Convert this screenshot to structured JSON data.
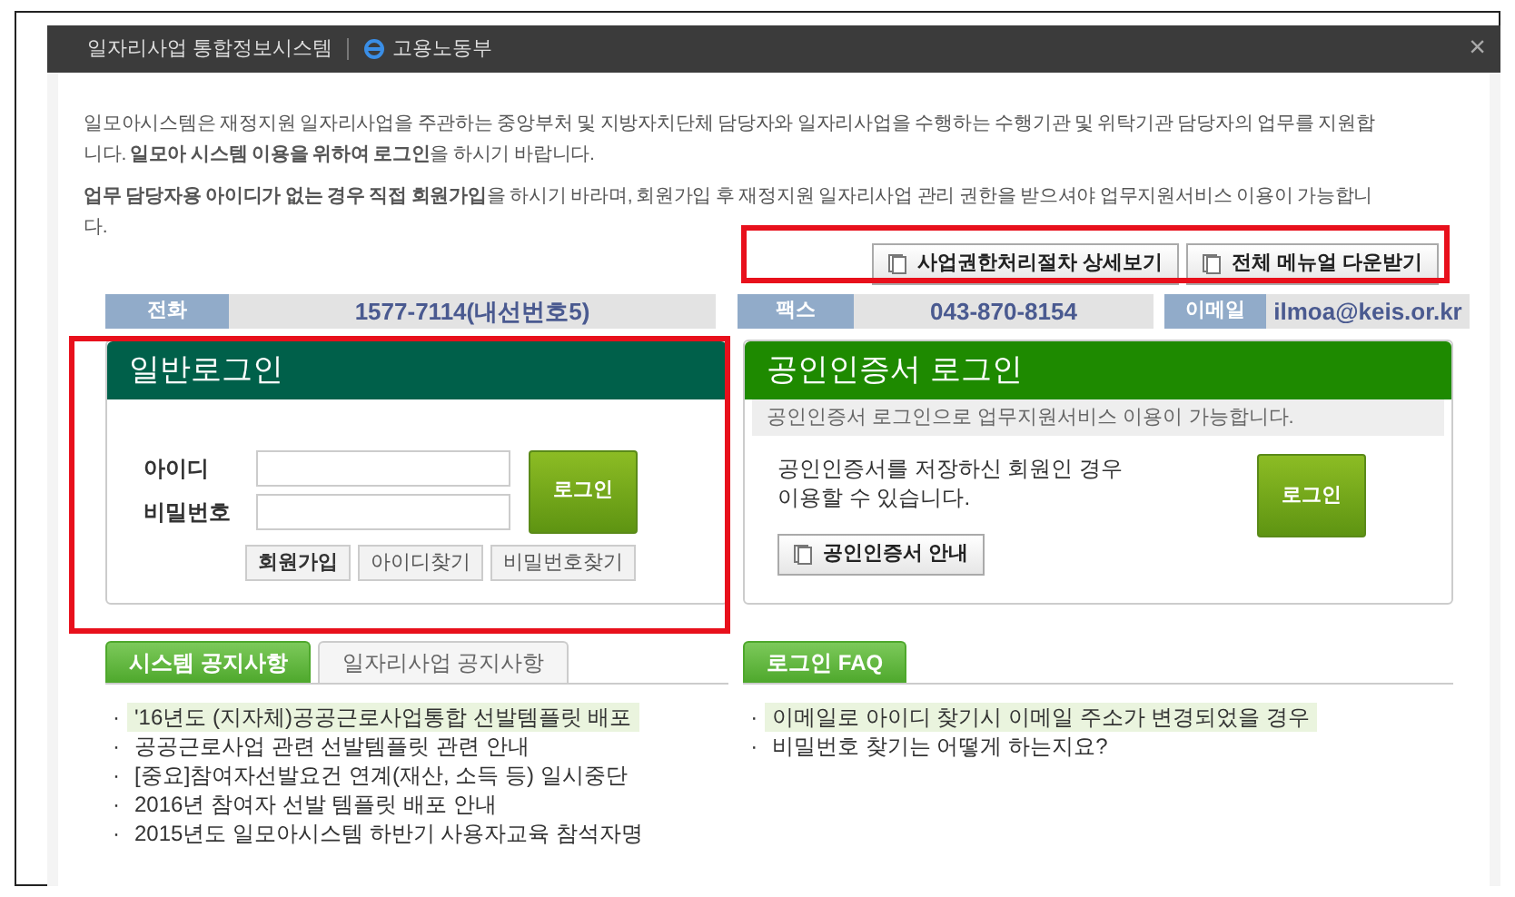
{
  "window": {
    "title_tabs": [
      {
        "label": "일자리사업 통합정보시스템",
        "kind": "text"
      },
      {
        "label": "고용노동부",
        "kind": "logo"
      }
    ],
    "close": "×"
  },
  "intro": [
    "일모아시스템은 재정지원 일자리사업을 주관하는 중앙부처 및 지방자치단체 담당자와 일자리사업을 수행하는 수행기관 및 위탁기관 담당자의 업무를 지원합니다. **일모아 시스템 이용을 위하여 로그인**을 하시기 바랍니다.",
    "**업무 담당자용 아이디가 없는 경우 직접 회원가입**을 하시기 바라며, 회원가입 후 재정지원 일자리사업 관리 권한을 받으셔야 업무지원서비스 이용이 가능합니다."
  ],
  "top_buttons": [
    "사업권한처리절차 상세보기",
    "전체 메뉴얼 다운받기"
  ],
  "contacts": [
    {
      "label": "전화",
      "value": "1577-7114(내선번호5)"
    },
    {
      "label": "팩스",
      "value": "043-870-8154"
    },
    {
      "label": "이메일",
      "value": "ilmoa@keis.or.kr"
    }
  ],
  "general_login": {
    "title": "일반로그인",
    "fields": [
      {
        "label": "아이디"
      },
      {
        "label": "비밀번호"
      }
    ],
    "login_button": "로그인",
    "links": [
      {
        "label": "회원가입",
        "bold": true
      },
      {
        "label": "아이디찾기",
        "bold": false
      },
      {
        "label": "비밀번호찾기",
        "bold": false
      }
    ]
  },
  "cert_login": {
    "title": "공인인증서 로그인",
    "subtitle": "공인인증서 로그인으로 업무지원서비스 이용이 가능합니다.",
    "note": "공인인증서를 저장하신 회원인 경우\n이용할 수 있습니다.",
    "login_button": "로그인",
    "guide_button": "공인인증서 안내"
  },
  "notices": {
    "tabs": [
      {
        "label": "시스템 공지사항",
        "selected": true
      },
      {
        "label": "일자리사업 공지사항",
        "selected": false
      }
    ],
    "items": [
      {
        "bullet": "·",
        "text": "'16년도 (지자체)공공근로사업통합 선발템플릿 배포",
        "highlighted": true
      },
      {
        "bullet": "·",
        "text": "공공근로사업 관련 선발템플릿 관련 안내",
        "highlighted": false
      },
      {
        "bullet": "·",
        "text": "[중요]참여자선발요건 연계(재산, 소득 등) 일시중단",
        "highlighted": false
      },
      {
        "bullet": "·",
        "text": "2016년 참여자 선발 템플릿 배포 안내",
        "highlighted": false
      },
      {
        "bullet": "·",
        "text": "2015년도 일모아시스템 하반기 사용자교육 참석자명",
        "highlighted": false
      }
    ]
  },
  "faq": {
    "tabs": [
      {
        "label": "로그인 FAQ",
        "selected": true
      }
    ],
    "items": [
      {
        "bullet": "·",
        "text": "이메일로 아이디 찾기시 이메일 주소가 변경되었을 경우",
        "highlighted": true
      },
      {
        "bullet": "·",
        "text": "비밀번호 찾기는 어떻게 하는지요?",
        "highlighted": false
      }
    ]
  }
}
